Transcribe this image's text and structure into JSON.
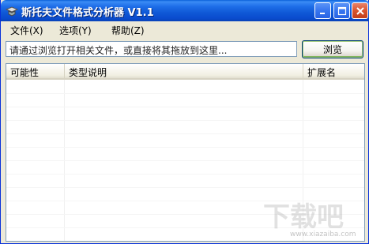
{
  "window": {
    "title": "斯托夫文件格式分析器 V1.1"
  },
  "menu": {
    "file": "文件(X)",
    "options": "选项(Y)",
    "help": "帮助(Z)"
  },
  "toolbar": {
    "path_placeholder": "请通过浏览打开相关文件，或直接将其拖放到这里...",
    "browse_label": "浏览"
  },
  "list": {
    "columns": [
      "可能性",
      "类型说明",
      "扩展名"
    ],
    "rows": []
  },
  "watermark": {
    "text": "下载吧",
    "url": "www.xiazaiba.com"
  },
  "colors": {
    "title_bar": "#0a4ccf",
    "button_face": "#ece9d8",
    "list_border": "#7f9db9"
  }
}
